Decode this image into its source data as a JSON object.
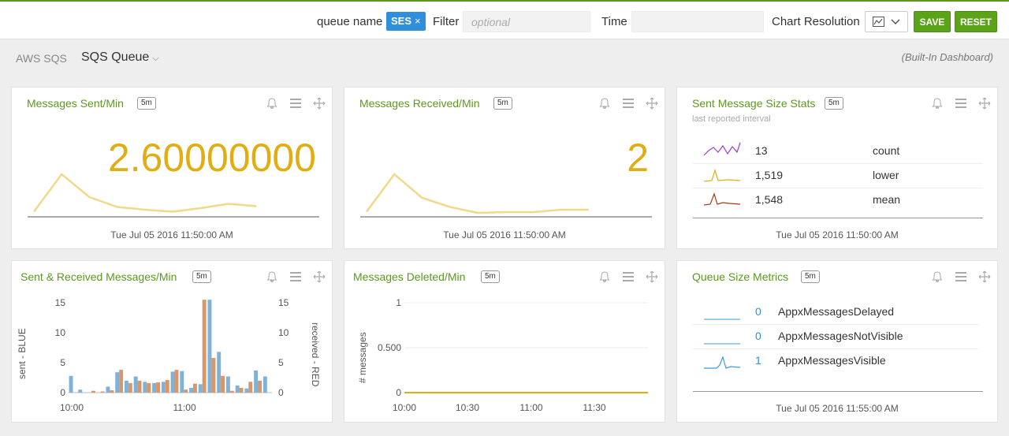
{
  "toolbar": {
    "queue_name_label": "queue name",
    "queue_tag": "SES",
    "queue_tag_remove": "×",
    "filter_label": "Filter",
    "filter_placeholder": "optional",
    "time_label": "Time",
    "time_value": "",
    "chart_resolution_label": "Chart Resolution",
    "save_label": "SAVE",
    "reset_label": "RESET"
  },
  "breadcrumb": {
    "root": "AWS SQS",
    "current": "SQS Queue",
    "dropdown_chevron": "⌵",
    "dashboard_note": "(Built-In Dashboard)"
  },
  "colors": {
    "accent": "#5b9a1d",
    "gold": "#e0ae12",
    "blue_bar": "#7fb2d6",
    "red_bar": "#d8966b"
  },
  "panels": {
    "sent": {
      "title": "Messages Sent/Min",
      "badge": "5m",
      "value": "2.60000000",
      "timestamp": "Tue Jul 05 2016 11:50:00 AM",
      "spark": [
        0.05,
        1.0,
        0.42,
        0.17,
        0.1,
        0.05,
        0.14,
        0.25,
        0.19
      ]
    },
    "received": {
      "title": "Messages Received/Min",
      "badge": "5m",
      "value": "2",
      "timestamp": "Tue Jul 05 2016 11:50:00 AM",
      "spark": [
        0.05,
        1.0,
        0.4,
        0.17,
        0.02,
        0.04,
        0.04,
        0.1,
        0.1
      ]
    },
    "size_stats": {
      "title": "Sent Message Size Stats",
      "badge": "5m",
      "subtitle": "last reported interval",
      "rows": [
        {
          "value": "13",
          "label": "count",
          "color": "#9b3fd0"
        },
        {
          "value": "1,519",
          "label": "lower",
          "color": "#e0ae12"
        },
        {
          "value": "1,548",
          "label": "mean",
          "color": "#a83a14"
        }
      ],
      "timestamp": "Tue Jul 05 2016 11:50:00 AM"
    },
    "sent_received": {
      "title": "Sent & Received Messages/Min",
      "badge": "5m",
      "left_axis_label": "sent - BLUE",
      "right_axis_label": "received - RED"
    },
    "deleted": {
      "title": "Messages Deleted/Min",
      "badge": "5m",
      "y_label": "# messages"
    },
    "queue_size": {
      "title": "Queue Size Metrics",
      "badge": "5m",
      "rows": [
        {
          "value": "0",
          "label": "AppxMessagesDelayed"
        },
        {
          "value": "0",
          "label": "AppxMessagesNotVisible"
        },
        {
          "value": "1",
          "label": "AppxMessagesVisible"
        }
      ],
      "timestamp": "Tue Jul 05 2016 11:55:00 AM"
    }
  },
  "chart_data": [
    {
      "type": "bar",
      "title": "Sent & Received Messages/Min",
      "ylabel": "sent - BLUE",
      "y2label": "received - RED",
      "ylim": [
        0,
        15
      ],
      "yticks": [
        "0",
        "5",
        "10",
        "15"
      ],
      "xticks": [
        "10:00",
        "11:00"
      ],
      "series": [
        {
          "name": "sent - BLUE",
          "color": "#7fb2d6",
          "values": [
            2.8,
            0.5,
            0,
            0,
            1.0,
            3.4,
            2.0,
            2.7,
            1.8,
            1.6,
            1.8,
            3.5,
            3.6,
            0.8,
            1.4,
            15.5,
            6.8,
            2.7,
            1.2,
            0.7,
            3.7,
            2.7
          ]
        },
        {
          "name": "received - RED",
          "color": "#d8966b",
          "values": [
            0,
            0,
            0.3,
            0.2,
            0.4,
            3.8,
            1.6,
            2.0,
            1.6,
            1.7,
            2.1,
            3.8,
            0.5,
            1.5,
            15.5,
            5.8,
            2.8,
            0.3,
            0.8,
            1.8,
            2.0,
            0
          ]
        }
      ]
    },
    {
      "type": "line",
      "title": "Messages Deleted/Min",
      "ylabel": "# messages",
      "ylim": [
        0,
        1
      ],
      "yticks": [
        "0",
        "0.500",
        "1"
      ],
      "xticks": [
        "10:00",
        "10:30",
        "11:00",
        "11:30"
      ],
      "series": [
        {
          "name": "deleted",
          "color": "#e0ae12",
          "values": [
            0,
            0,
            0,
            0,
            0,
            0,
            0,
            0,
            0,
            0
          ]
        }
      ]
    }
  ]
}
